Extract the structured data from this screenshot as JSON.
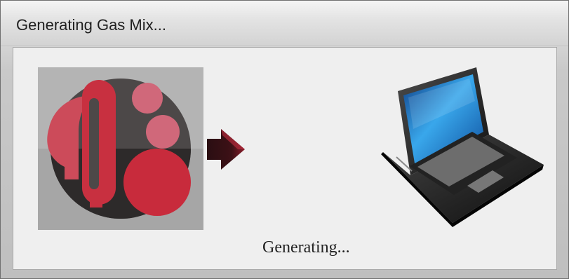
{
  "window": {
    "title": "Generating Gas Mix..."
  },
  "content": {
    "status_text": "Generating...",
    "icons": {
      "source": "gas-mix-logo-icon",
      "direction": "arrow-right-icon",
      "target": "laptop-icon"
    }
  },
  "colors": {
    "accent_red": "#c92f42",
    "logo_dark": "#2e2b2b",
    "logo_background": "#b3b3b3"
  }
}
